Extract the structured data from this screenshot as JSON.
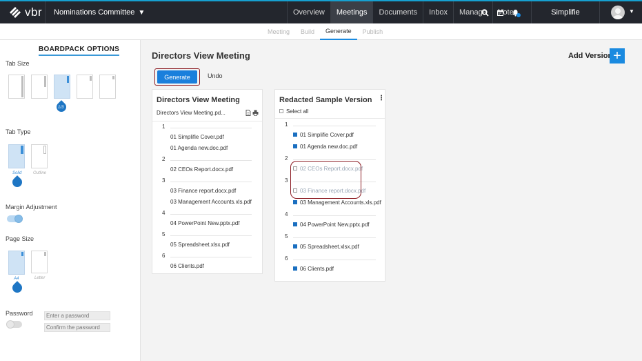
{
  "topbar": {
    "logo_text": "vbr",
    "org_name": "Nominations Committee",
    "nav": [
      "Overview",
      "Meetings",
      "Documents",
      "Inbox",
      "Manage",
      "Votes"
    ],
    "active_nav": "Meetings",
    "user_name": "Simplifie"
  },
  "subtabs": [
    "Meeting",
    "Build",
    "Generate",
    "Publish"
  ],
  "active_subtab": "Generate",
  "options": {
    "title": "BOARDPACK OPTIONS",
    "tab_size_label": "Tab Size",
    "tab_size_selected": "1/3",
    "tab_type_label": "Tab Type",
    "tab_type_options": [
      "Solid",
      "Outline"
    ],
    "margin_label": "Margin Adjustment",
    "margin_enabled": true,
    "page_size_label": "Page Size",
    "page_size_options": [
      "A4",
      "Letter"
    ],
    "password_label": "Password",
    "password_enabled": false,
    "password_placeholder": "Enter a password",
    "confirm_placeholder": "Confirm the password"
  },
  "main": {
    "page_title": "Directors View Meeting",
    "add_version_label": "Add Version",
    "add_symbol": "+",
    "generate_label": "Generate",
    "undo_label": "Undo"
  },
  "original_card": {
    "title": "Directors View Meeting",
    "file": "Directors View Meeting.pd...",
    "sections": [
      {
        "num": "1",
        "docs": [
          "01 Simplifie Cover.pdf",
          "01 Agenda new.doc.pdf"
        ]
      },
      {
        "num": "2",
        "docs": [
          "02 CEOs Report.docx.pdf"
        ]
      },
      {
        "num": "3",
        "docs": [
          "03 Finance report.docx.pdf",
          "03 Management Accounts.xls.pdf"
        ]
      },
      {
        "num": "4",
        "docs": [
          "04 PowerPoint New.pptx.pdf"
        ]
      },
      {
        "num": "5",
        "docs": [
          "05 Spreadsheet.xlsx.pdf"
        ]
      },
      {
        "num": "6",
        "docs": [
          "06 Clients.pdf"
        ]
      }
    ]
  },
  "redacted_card": {
    "title": "Redacted Sample Version",
    "select_all": "Select all",
    "menu_symbol": "⋮",
    "sections": [
      {
        "num": "1",
        "docs": [
          {
            "name": "01 Simplifie Cover.pdf",
            "checked": true
          },
          {
            "name": "01 Agenda new.doc.pdf",
            "checked": true
          }
        ]
      },
      {
        "num": "2",
        "docs": [
          {
            "name": "02 CEOs Report.docx.pdf",
            "checked": false
          }
        ]
      },
      {
        "num": "3",
        "docs": [
          {
            "name": "03 Finance report.docx.pdf",
            "checked": false
          },
          {
            "name": "03 Management Accounts.xls.pdf",
            "checked": true
          }
        ]
      },
      {
        "num": "4",
        "docs": [
          {
            "name": "04 PowerPoint New.pptx.pdf",
            "checked": true
          }
        ]
      },
      {
        "num": "5",
        "docs": [
          {
            "name": "05 Spreadsheet.xlsx.pdf",
            "checked": true
          }
        ]
      },
      {
        "num": "6",
        "docs": [
          {
            "name": "06 Clients.pdf",
            "checked": true
          }
        ]
      }
    ]
  },
  "colors": {
    "topbar": "#23262d",
    "accent": "#1a8ae0",
    "highlight": "#8c1b22"
  }
}
